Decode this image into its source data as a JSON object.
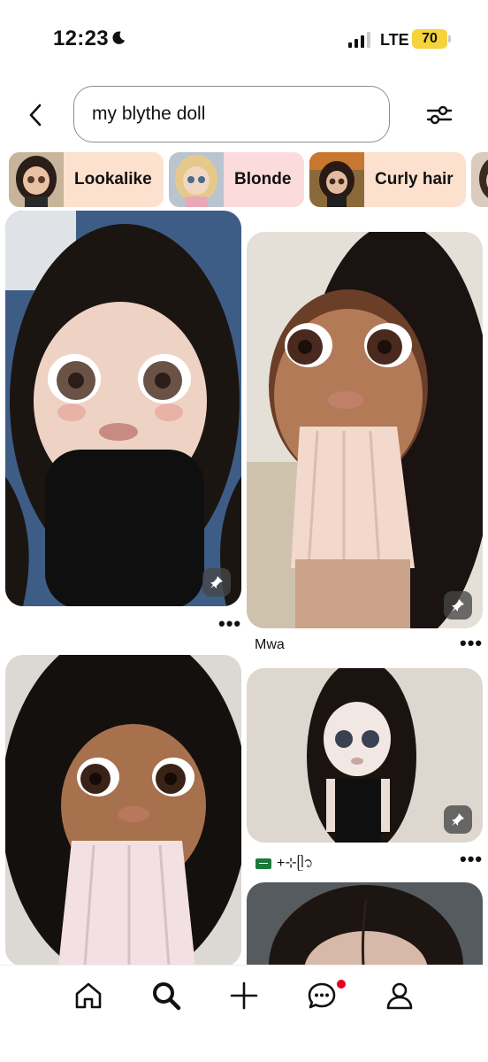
{
  "status_bar": {
    "time": "12:23",
    "network": "LTE",
    "battery": "70",
    "icons": [
      "moon-icon",
      "signal-icon"
    ],
    "battery_color": "#f5d33a"
  },
  "search": {
    "query": "my blythe doll",
    "back_icon": "chevron-left-icon",
    "filter_icon": "sliders-icon"
  },
  "chips": [
    {
      "label": "Lookalike",
      "bg": "#fde1cf"
    },
    {
      "label": "Blonde",
      "bg": "#fcdbdd"
    },
    {
      "label": "Curly hair",
      "bg": "#fde1cf"
    }
  ],
  "pins": [
    {
      "title": "",
      "more": "•••"
    },
    {
      "title": "Mwa",
      "more": "•••"
    },
    {
      "title": "",
      "more": ""
    },
    {
      "title": "+⊹ᥫ᭡",
      "more": "•••"
    },
    {
      "title": "",
      "more": ""
    }
  ],
  "nav": {
    "items": [
      "home-icon",
      "search-icon",
      "plus-icon",
      "messages-icon",
      "profile-icon"
    ],
    "notification_color": "#e60023"
  }
}
